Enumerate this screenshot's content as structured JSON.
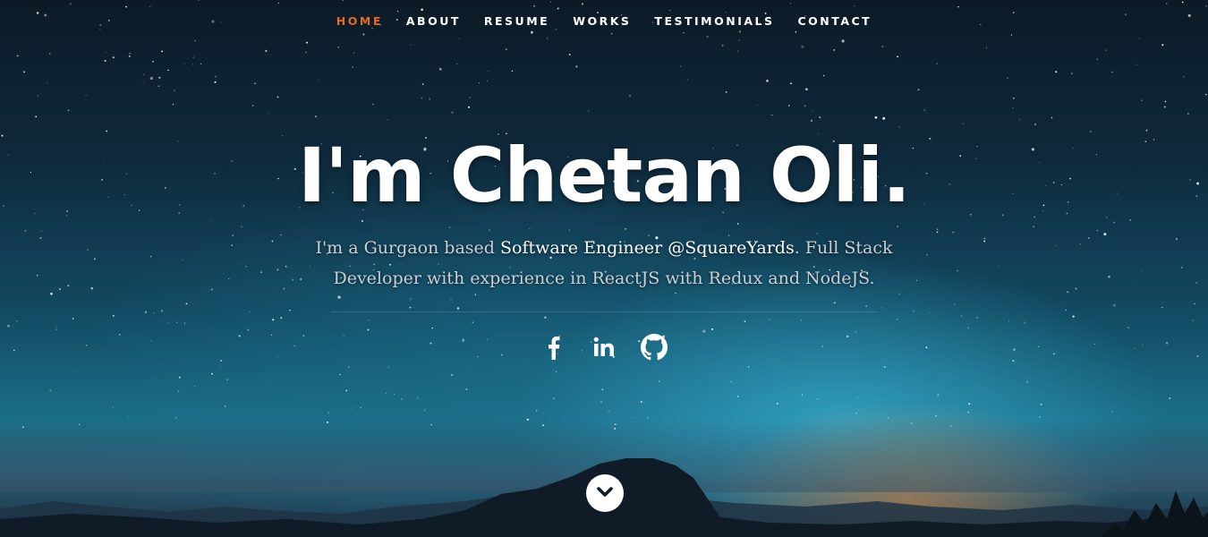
{
  "nav": {
    "items": [
      {
        "label": "HOME",
        "active": true
      },
      {
        "label": "ABOUT",
        "active": false
      },
      {
        "label": "RESUME",
        "active": false
      },
      {
        "label": "WORKS",
        "active": false
      },
      {
        "label": "TESTIMONIALS",
        "active": false
      },
      {
        "label": "CONTACT",
        "active": false
      }
    ],
    "active_color": "#e56a1e"
  },
  "banner": {
    "headline": "I'm Chetan Oli.",
    "intro_part1": "I'm a Gurgaon based ",
    "intro_highlight": "Software Engineer @SquareYards",
    "intro_part2": ". Full Stack Developer with experience in ReactJS with Redux and NodeJS."
  },
  "social": [
    {
      "icon": "facebook-icon"
    },
    {
      "icon": "linkedin-icon"
    },
    {
      "icon": "github-icon"
    }
  ],
  "scroll": {
    "icon": "chevron-down-icon"
  }
}
